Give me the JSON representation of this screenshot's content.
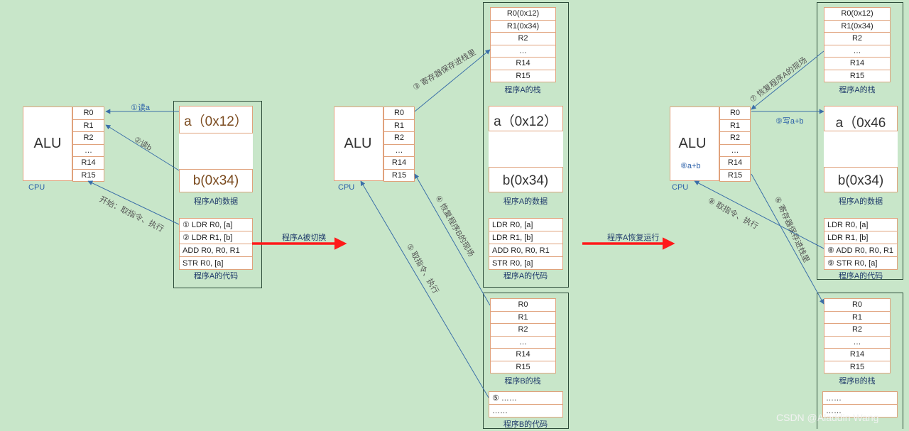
{
  "registers": [
    "R0",
    "R1",
    "R2",
    "…",
    "R14",
    "R15"
  ],
  "alu_label": "ALU",
  "cpu_label": "CPU",
  "data_caption": "程序A的数据",
  "code_caption": "程序A的代码",
  "stack_a_caption": "程序A的栈",
  "stack_b_caption": "程序B的栈",
  "code_b_caption": "程序B的代码",
  "stack_a_regs": [
    "R0(0x12)",
    "R1(0x34)",
    "R2",
    "…",
    "R14",
    "R15"
  ],
  "panel1": {
    "data_a": "a（0x12）",
    "data_b": "b(0x34)",
    "code_lines": [
      "① LDR  R0, [a]",
      "② LDR  R1, [b]",
      "ADD R0, R0, R1",
      "STR R0, [a]"
    ],
    "arrow_read_a": "①读a",
    "arrow_read_b": "②读b",
    "arrow_start": "开始：取指令、执行"
  },
  "switch_label": "程序A被切换",
  "panel2": {
    "data_a": "a（0x12）",
    "data_b": "b(0x34)",
    "code_lines": [
      "LDR  R0, [a]",
      "LDR  R1, [b]",
      "ADD R0, R0, R1",
      "STR R0, [a]"
    ],
    "code_b_lines": [
      "⑤ ……",
      "……"
    ],
    "arrow_save": "③ 寄存器保存进栈里",
    "arrow_restore_b": "④ 恢复程序B的现场",
    "arrow_fetch": "⑤ 取指令、执行"
  },
  "resume_label": "程序A恢复运行",
  "panel3": {
    "alu_sub": "⑧a+b",
    "data_a": "a（0x46",
    "data_b": "b(0x34)",
    "code_lines": [
      "LDR  R0, [a]",
      "LDR  R1, [b]",
      "⑧ ADD R0, R0, R1",
      "⑨ STR R0, [a]"
    ],
    "code_b_lines": [
      "……",
      "……"
    ],
    "arrow_restore_a": "⑦ 恢复程序A的现场",
    "arrow_write": "⑨写a+b",
    "arrow_fetch": "⑧ 取指令、执行",
    "arrow_save": "⑥ 寄存器保存进栈里"
  },
  "watermark": "CSDN @Aladdin Wang",
  "colors": {
    "background": "#c8e6c9",
    "box_border": "#e0a27c",
    "frame_border": "#2e4d3a",
    "arrow_blue": "#3b6fa8",
    "arrow_red": "#ff1a1a"
  }
}
